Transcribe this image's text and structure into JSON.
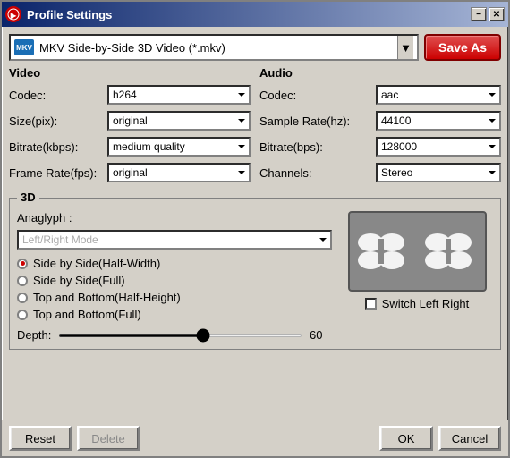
{
  "window": {
    "title": "Profile Settings",
    "icon_label": "PS"
  },
  "title_controls": {
    "minimize": "−",
    "close": "✕"
  },
  "format": {
    "icon_text": "MKV",
    "selected": "MKV Side-by-Side 3D Video (*.mkv)"
  },
  "save_as_label": "Save As",
  "video": {
    "section_title": "Video",
    "codec_label": "Codec:",
    "codec_value": "h264",
    "size_label": "Size(pix):",
    "size_value": "original",
    "bitrate_label": "Bitrate(kbps):",
    "bitrate_value": "medium quality",
    "framerate_label": "Frame Rate(fps):",
    "framerate_value": "original"
  },
  "audio": {
    "section_title": "Audio",
    "codec_label": "Codec:",
    "codec_value": "aac",
    "samplerate_label": "Sample Rate(hz):",
    "samplerate_value": "44100",
    "bitrate_label": "Bitrate(bps):",
    "bitrate_value": "128000",
    "channels_label": "Channels:",
    "channels_value": "Stereo"
  },
  "threed": {
    "section_title": "3D",
    "anaglyph_label": "Anaglyph :",
    "anaglyph_placeholder": "Left/Right Mode",
    "modes": [
      {
        "label": "Side by Side(Half-Width)",
        "selected": true
      },
      {
        "label": "Side by Side(Full)",
        "selected": false
      },
      {
        "label": "Top and Bottom(Half-Height)",
        "selected": false
      },
      {
        "label": "Top and Bottom(Full)",
        "selected": false
      }
    ],
    "depth_label": "Depth:",
    "depth_value": "60",
    "switch_label": "Switch Left Right"
  },
  "buttons": {
    "reset": "Reset",
    "delete": "Delete",
    "ok": "OK",
    "cancel": "Cancel"
  }
}
